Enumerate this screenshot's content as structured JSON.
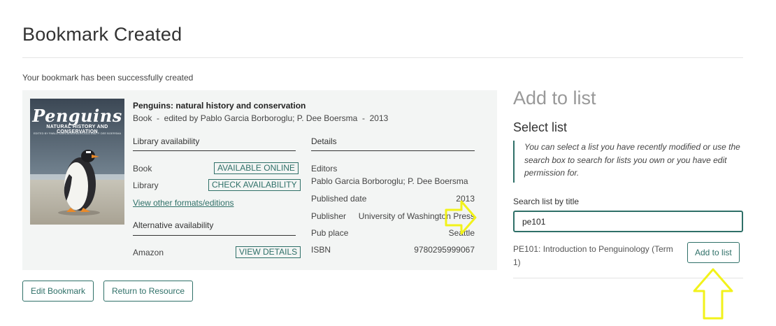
{
  "page": {
    "title": "Bookmark Created",
    "success_message": "Your bookmark has been successfully created"
  },
  "resource": {
    "cover": {
      "title": "Penguins",
      "subtitle": "NATURAL HISTORY AND CONSERVATION",
      "byline": "EDITED BY PABLO GARCIA BORBOROGLU AND P. DEE BOERSMA"
    },
    "title": "Penguins: natural history and conservation",
    "meta": "Book  -  edited by Pablo Garcia Borboroglu; P. Dee Boersma  -  2013",
    "library_availability": {
      "heading": "Library availability",
      "rows": [
        {
          "label": "Book",
          "action": "AVAILABLE ONLINE"
        },
        {
          "label": "Library",
          "action": "CHECK AVAILABILITY"
        }
      ],
      "other_formats_link": "View other formats/editions"
    },
    "alternative_availability": {
      "heading": "Alternative availability",
      "rows": [
        {
          "label": "Amazon",
          "action": "VIEW DETAILS"
        }
      ]
    },
    "details": {
      "heading": "Details",
      "editors_label": "Editors",
      "editors_value": "Pablo Garcia Borboroglu; P. Dee Boersma",
      "published_date_label": "Published date",
      "published_date_value": "2013",
      "publisher_label": "Publisher",
      "publisher_value": "University of Washington Press",
      "pub_place_label": "Pub place",
      "pub_place_value": "Seattle",
      "isbn_label": "ISBN",
      "isbn_value": "9780295999067"
    }
  },
  "actions": {
    "edit_bookmark": "Edit Bookmark",
    "return_to_resource": "Return to Resource"
  },
  "add_to_list": {
    "title": "Add to list",
    "subtitle": "Select list",
    "help_text": "You can select a list you have recently modified or use the search box to search for lists you own or you have edit permission for.",
    "search_label": "Search list by title",
    "search_value": "pe101",
    "result_label": "PE101: Introduction to Penguinology (Term 1)",
    "add_button": "Add to list"
  },
  "colors": {
    "accent": "#2f7068",
    "annotation_arrow": "#f2f21a",
    "card_background": "#f3f5f4"
  }
}
